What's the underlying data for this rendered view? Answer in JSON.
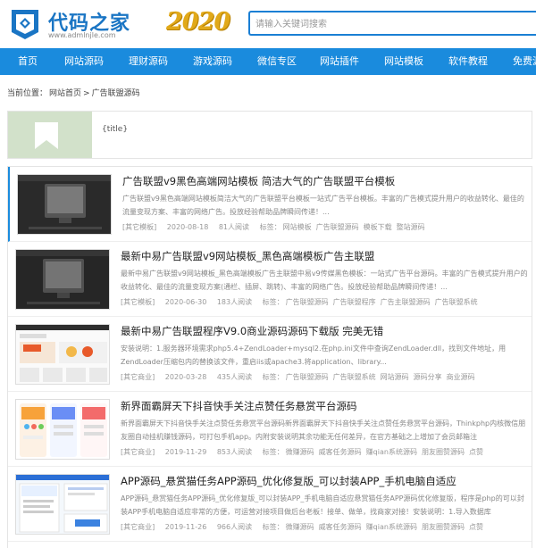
{
  "header": {
    "logo_text": "代码之家",
    "logo_url": "www.admlnjle.com",
    "year": "2020",
    "search_placeholder": "请输入关键词搜索"
  },
  "nav": [
    "首页",
    "网站源码",
    "理财源码",
    "游戏源码",
    "微信专区",
    "网站插件",
    "网站模板",
    "软件教程",
    "免费源码"
  ],
  "breadcrumb": {
    "prefix": "当前位置：",
    "home": "网站首页",
    "sep": ">",
    "current": "广告联盟源码"
  },
  "banner": {
    "title": "{title}"
  },
  "items": [
    {
      "title": "广告联盟v9黑色高端网站模板 简洁大气的广告联盟平台模板",
      "desc": "广告联盟v9黑色高端网站模板简洁大气的广告联盟平台模板一站式广告平台模板。丰富的广告模式提升用户的收益转化、最佳的流量变现方案、丰富的网络广告。投放经验帮助品牌瞬间传递！...",
      "category": "[其它模板]",
      "date": "2020-08-18",
      "views": "81人阅读",
      "tags_label": "标签：",
      "tags": [
        "网站模板",
        "广告联盟源码",
        "模板下载",
        "整站源码"
      ]
    },
    {
      "title": "最新中易广告联盟v9网站模板_黑色高端模板广告主联盟",
      "desc": "最新中易广告联盟v9网站模板_黑色高端模板广告主联盟中易v9传媒黑色模板：一站式广告平台源码。丰富的广告模式提升用户的收益转化、最佳的流量变现方案(通栏、插屏、跳转)、丰富的网络广告。投放经验帮助品牌瞬间传递！...",
      "category": "[其它模板]",
      "date": "2020-06-30",
      "views": "183人阅读",
      "tags_label": "标签：",
      "tags": [
        "广告联盟源码",
        "广告联盟程序",
        "广告主联盟源码",
        "广告联盟系统"
      ]
    },
    {
      "title": "最新中易广告联盟程序V9.0商业源码源码下载版 完美无错",
      "desc": "安装说明：1.服务器环境需求php5.4+ZendLoader+mysql2.在php.ini文件中查询ZendLoader.dll，找到文件地址，用ZendLoader压缩包内的替换该文件，重启iis或apache3.将application、library...",
      "category": "[其它商业]",
      "date": "2020-03-28",
      "views": "435人阅读",
      "tags_label": "标签：",
      "tags": [
        "广告联盟源码",
        "广告联盟系统",
        "网站源码",
        "源码分享",
        "商业源码"
      ]
    },
    {
      "title": "新界面霸屏天下抖音快手关注点赞任务悬赏平台源码",
      "desc": "新界面霸屏天下抖音快手关注点赞任务悬赏平台源码新界面霸屏天下抖音快手关注点赞任务悬赏平台源码，Thinkphp内核微信朋友圈自动挂机赚钱源码，可打包手机app。内附安装说明其余功能无任何差异，在官方基础之上增加了会员邮箱注",
      "category": "[其它商业]",
      "date": "2019-11-29",
      "views": "853人阅读",
      "tags_label": "标签：",
      "tags": [
        "微赚源码",
        "威客任务源码",
        "赚qian系统源码",
        "朋友圈赞源码",
        "点赞"
      ]
    },
    {
      "title": "APP源码_悬赏猫任务APP源码_优化修复版_可以封装APP_手机电脑自适应",
      "desc": "APP源码_悬赏猫任务APP源码_优化修复版_可以封装APP_手机电脑自适应悬赏猫任务APP源码优化修复版，程序是php的可以封装APP手机电脑自适应非常的方便，可运营对接项目做后台老板！接单、做单，找商家对接！安装说明：1.导入数据库",
      "category": "[其它商业]",
      "date": "2019-11-26",
      "views": "966人阅读",
      "tags_label": "标签：",
      "tags": [
        "微赚源码",
        "威客任务源码",
        "赚qian系统源码",
        "朋友圈赞源码",
        "点赞"
      ]
    }
  ],
  "colors": {
    "primary": "#1a8bdd",
    "logo": "#1a75c4",
    "year": "#e1a91a",
    "banner_bg": "#d2e1ca"
  },
  "icons": {
    "banner": "bookmark-icon",
    "logo": "logo-diamond-icon"
  }
}
